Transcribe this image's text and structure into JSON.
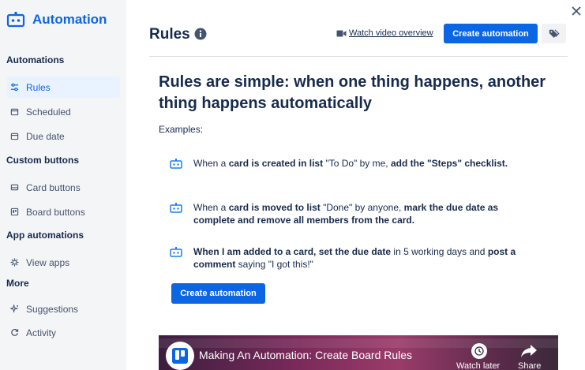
{
  "sidebar": {
    "title": "Automation",
    "sections": {
      "automations": "Automations",
      "custom_buttons": "Custom buttons",
      "app_automations": "App automations",
      "more": "More"
    },
    "items": {
      "rules": "Rules",
      "scheduled": "Scheduled",
      "due_date": "Due date",
      "card_buttons": "Card buttons",
      "board_buttons": "Board buttons",
      "view_apps": "View apps",
      "suggestions": "Suggestions",
      "activity": "Activity"
    }
  },
  "header": {
    "title": "Rules",
    "watch_video": "Watch video overview",
    "create_automation": "Create automation"
  },
  "main": {
    "heading": "Rules are simple: when one thing happens, another thing happens automatically",
    "examples_label": "Examples:",
    "example1": {
      "p1": "When a ",
      "b1": "card is created in list",
      "p2": " \"To Do\" by me, ",
      "b2": "add the \"Steps\" checklist."
    },
    "example2": {
      "p1": "When a ",
      "b1": "card is moved to list",
      "p2": " \"Done\" by anyone, ",
      "b2": "mark the due date as complete and remove all members from the card."
    },
    "example3": {
      "b1": "When I am added to a card, set the due date",
      "p1": " in 5 working days and ",
      "b2": "post a comment",
      "p2": " saying \"I got this!\""
    },
    "create_automation": "Create automation"
  },
  "video": {
    "title": "Making An Automation: Create Board Rules",
    "watch_later": "Watch later",
    "share": "Share"
  },
  "colors": {
    "accent": "#0c66e4",
    "sidebar_bg": "#f4f5f7",
    "active_bg": "#e9f2ff",
    "text": "#172b4d"
  },
  "icons": {
    "brand": "robot-icon",
    "info": "info-icon",
    "video": "video-camera-icon",
    "tag": "tag-icon",
    "close": "close-icon"
  }
}
